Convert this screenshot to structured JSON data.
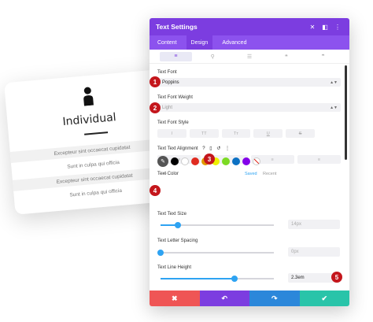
{
  "card": {
    "title": "Individual",
    "lines": [
      "Excepteur sint occaecat cupidatat",
      "Sunt in culpa qui officia",
      "Excepteur sint occaecat cupidatat",
      "Sunt in culpa qui officia"
    ]
  },
  "panel": {
    "title": "Text Settings",
    "tabs": [
      "Content",
      "Design",
      "Advanced"
    ],
    "active_tab": "Design",
    "header_icons": [
      "close-icon",
      "split-icon",
      "more-icon"
    ],
    "subtab_icons": [
      "align-icon",
      "link-icon",
      "list-icon",
      "quote-icon",
      "quote-close-icon"
    ],
    "text_font": {
      "label": "Text Font",
      "value": "Poppins"
    },
    "text_font_weight": {
      "label": "Text Font Weight",
      "value": "Light"
    },
    "text_font_style": {
      "label": "Text Font Style",
      "buttons": [
        "I",
        "TT",
        "Tт",
        "U",
        "S"
      ]
    },
    "text_alignment": {
      "label": "Text Text Alignment",
      "icons": [
        "?",
        "▯",
        "↺",
        "⋮"
      ],
      "buttons": [
        "≡",
        "≡",
        "≡",
        "≡"
      ]
    },
    "text_color": {
      "label": "Text Color",
      "swatches": [
        "#000000",
        "#ffffff",
        "#e02b20",
        "#e09900",
        "#edf000",
        "#7cda24",
        "#0c71c3",
        "#8300e9"
      ],
      "saved": "Saved",
      "recent": "Recent",
      "dots": "•••"
    },
    "text_size": {
      "label": "Text Text Size",
      "value": "14px",
      "fraction": 0.15
    },
    "letter_spacing": {
      "label": "Text Letter Spacing",
      "value": "0px",
      "fraction": 0.0
    },
    "line_height": {
      "label": "Text Line Height",
      "value": "2.3em",
      "fraction": 0.65
    },
    "footer": {
      "cancel": "✖",
      "undo": "↶",
      "redo": "↷",
      "save": "✔"
    }
  },
  "badges": [
    "1",
    "2",
    "3",
    "4",
    "5"
  ],
  "colors": {
    "purple": "#7c3de0",
    "purple_light": "#8c52ee",
    "blue": "#2ea3f2",
    "red": "#ef5555",
    "green": "#29c4a9",
    "badge": "#c4161c"
  }
}
